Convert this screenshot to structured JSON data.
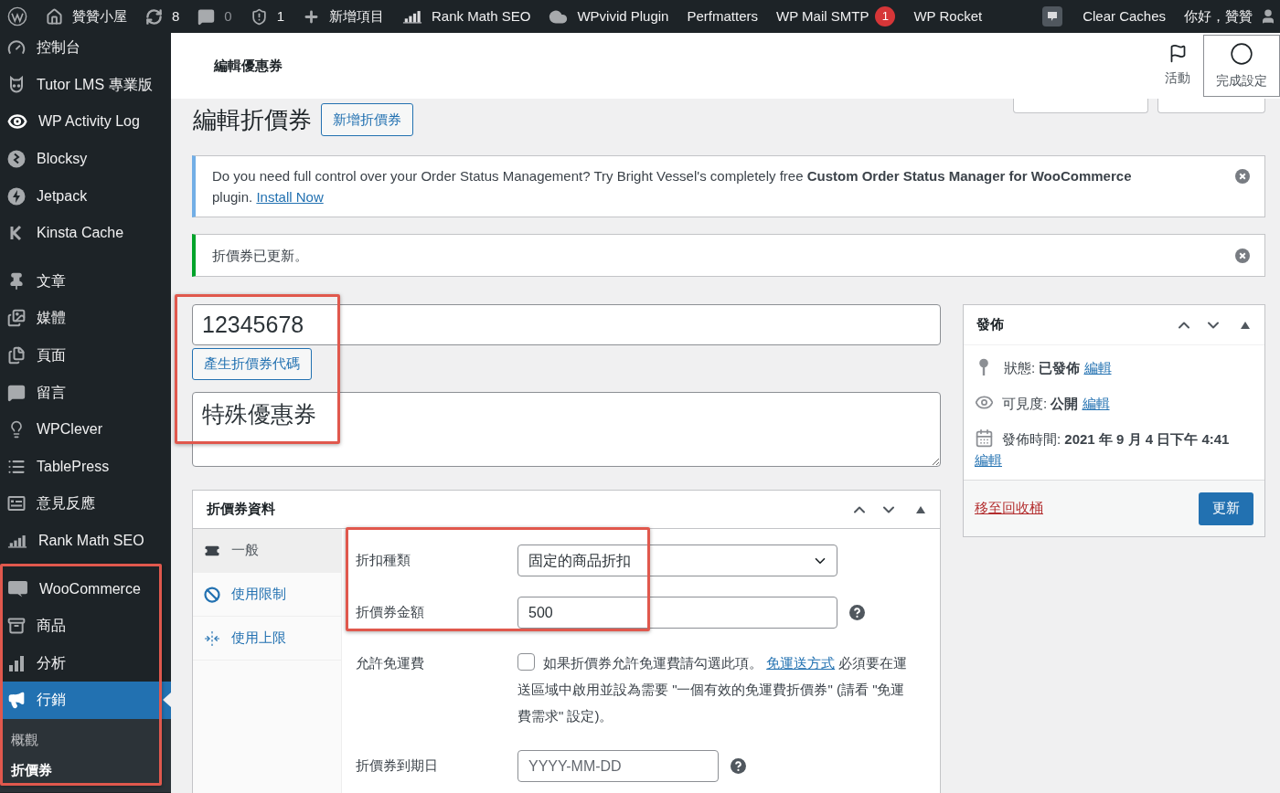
{
  "admin_bar": {
    "items": [
      {
        "kind": "home",
        "label": "贊贊小屋"
      },
      {
        "kind": "updates",
        "label": "8"
      },
      {
        "kind": "comments",
        "label": "0"
      },
      {
        "kind": "shield",
        "label": "1"
      },
      {
        "kind": "new",
        "label": "新增項目"
      },
      {
        "kind": "rankmath",
        "label": "Rank Math SEO"
      },
      {
        "kind": "cloud",
        "label": "WPvivid Plugin"
      },
      {
        "kind": "text",
        "label": "Perfmatters"
      },
      {
        "kind": "text",
        "label": "WP Mail SMTP",
        "badge": "1"
      },
      {
        "kind": "text",
        "label": "WP Rocket"
      }
    ],
    "secondary": [
      {
        "kind": "text",
        "label": "Clear Caches"
      },
      {
        "kind": "account",
        "label": "你好，贊贊"
      }
    ]
  },
  "sidebar": {
    "groups": [
      {
        "items": [
          {
            "kind": "dashboard",
            "label": "控制台",
            "selected": false
          },
          {
            "kind": "tutor",
            "label": "Tutor LMS 專業版",
            "selected": false
          },
          {
            "kind": "activity",
            "label": "WP Activity Log",
            "selected": false
          },
          {
            "kind": "blocksy",
            "label": "Blocksy",
            "selected": false
          },
          {
            "kind": "jetpack",
            "label": "Jetpack",
            "selected": false
          },
          {
            "kind": "kinsta",
            "label": "Kinsta Cache",
            "selected": false
          }
        ]
      },
      {
        "items": [
          {
            "kind": "posts",
            "label": "文章",
            "selected": false
          },
          {
            "kind": "media",
            "label": "媒體",
            "selected": false
          },
          {
            "kind": "pages",
            "label": "頁面",
            "selected": false
          },
          {
            "kind": "comments",
            "label": "留言",
            "selected": false
          },
          {
            "kind": "wpclever",
            "label": "WPClever",
            "selected": false
          },
          {
            "kind": "tablepress",
            "label": "TablePress",
            "selected": false
          },
          {
            "kind": "feedback",
            "label": "意見反應",
            "selected": false
          },
          {
            "kind": "rankmath",
            "label": "Rank Math SEO",
            "selected": false
          }
        ]
      },
      {
        "items": [
          {
            "kind": "woocommerce",
            "label": "WooCommerce",
            "selected": false
          },
          {
            "kind": "products",
            "label": "商品",
            "selected": false
          },
          {
            "kind": "analytics",
            "label": "分析",
            "selected": false
          },
          {
            "kind": "marketing",
            "label": "行銷",
            "selected": true,
            "children": [
              {
                "label": "概觀",
                "selected": false
              },
              {
                "label": "折價券",
                "selected": true
              }
            ]
          }
        ]
      }
    ]
  },
  "header": {
    "title": "編輯優惠券",
    "actions": [
      {
        "kind": "flag",
        "label": "活動",
        "selected": false
      },
      {
        "kind": "circle",
        "label": "完成設定",
        "selected": true
      }
    ]
  },
  "page": {
    "title": "編輯折價券",
    "add_button": "新增折價券"
  },
  "notices": [
    {
      "kind": "info",
      "text": "Do you need full control over your Order Status Management? Try Bright Vessel's completely free **Custom Order Status Manager for WooCommerce** plugin.",
      "link": "Install Now"
    },
    {
      "kind": "success",
      "text": "折價券已更新。"
    }
  ],
  "coupon": {
    "code": "12345678",
    "generate_button": "產生折價券代碼",
    "description": "特殊優惠券"
  },
  "coupon_data": {
    "title": "折價券資料",
    "tabs": [
      {
        "kind": "ticket",
        "label": "一般",
        "selected": true
      },
      {
        "kind": "restriction",
        "label": "使用限制",
        "selected": false
      },
      {
        "kind": "limit",
        "label": "使用上限",
        "selected": false
      }
    ],
    "fields": [
      {
        "kind": "select",
        "label": "折扣種類",
        "value": "固定的商品折扣",
        "help": false
      },
      {
        "kind": "text",
        "label": "折價券金額",
        "value": "500",
        "help": true
      },
      {
        "kind": "checkbox",
        "label": "允許免運費",
        "checked": false,
        "text_before": "如果折價券允許免運費請勾選此項。",
        "link": "免運送方式",
        "text_after": "必須要在運送區域中啟用並設為需要 \"一個有效的免運費折價券\" (請看 \"免運費需求\" 設定)。",
        "help": false
      },
      {
        "kind": "date",
        "label": "折價券到期日",
        "placeholder": "YYYY-MM-DD",
        "help": true
      }
    ]
  },
  "publish": {
    "title": "發佈",
    "rows": [
      {
        "kind": "status",
        "text": "狀態: **已發佈**",
        "link": "編輯"
      },
      {
        "kind": "visibility",
        "text": "可見度: **公開**",
        "link": "編輯"
      },
      {
        "kind": "date",
        "text": "發佈時間: **2021 年 9 月 4 日下午 4:41**",
        "link": "編輯"
      }
    ],
    "trash_link": "移至回收桶",
    "update_button": "更新"
  }
}
